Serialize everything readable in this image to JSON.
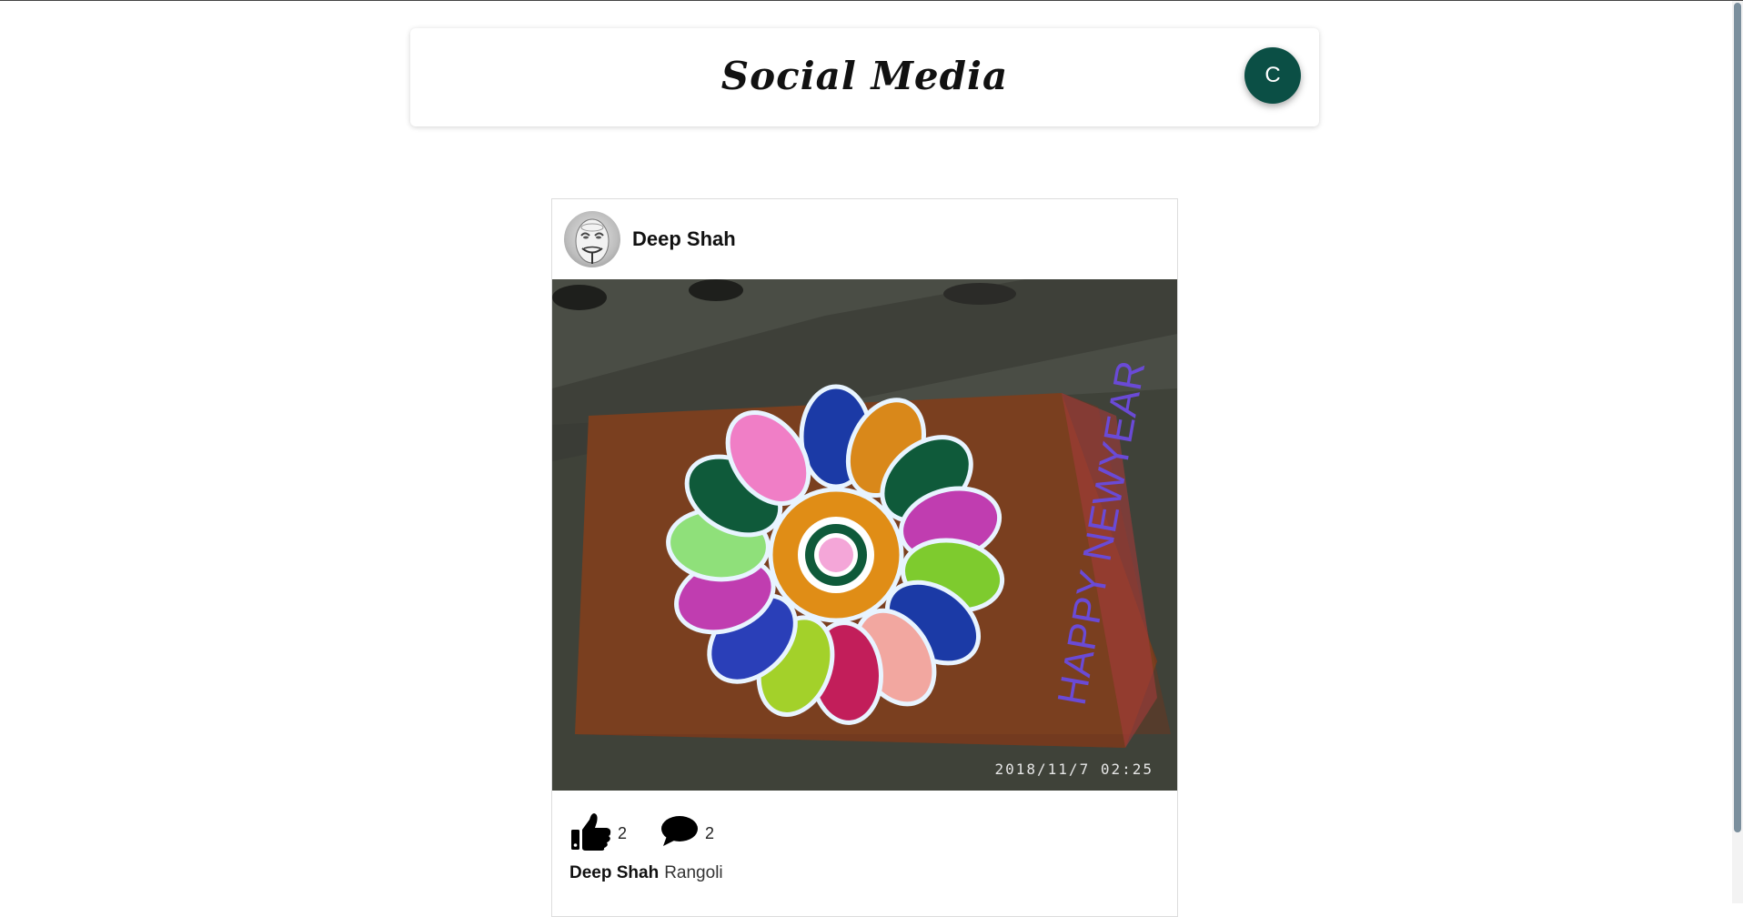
{
  "header": {
    "title": "Social Media",
    "user_initial": "C",
    "avatar_color": "#0b4f45"
  },
  "post": {
    "author": "Deep Shah",
    "image_description_icon": "rangoli-photo",
    "photo_timestamp": "2018/11/7  02:25",
    "likes": "2",
    "comments": "2",
    "caption_author": "Deep Shah",
    "caption_text": "Rangoli"
  },
  "icons": {
    "like": "thumbs-up-icon",
    "comment": "speech-bubble-icon"
  }
}
